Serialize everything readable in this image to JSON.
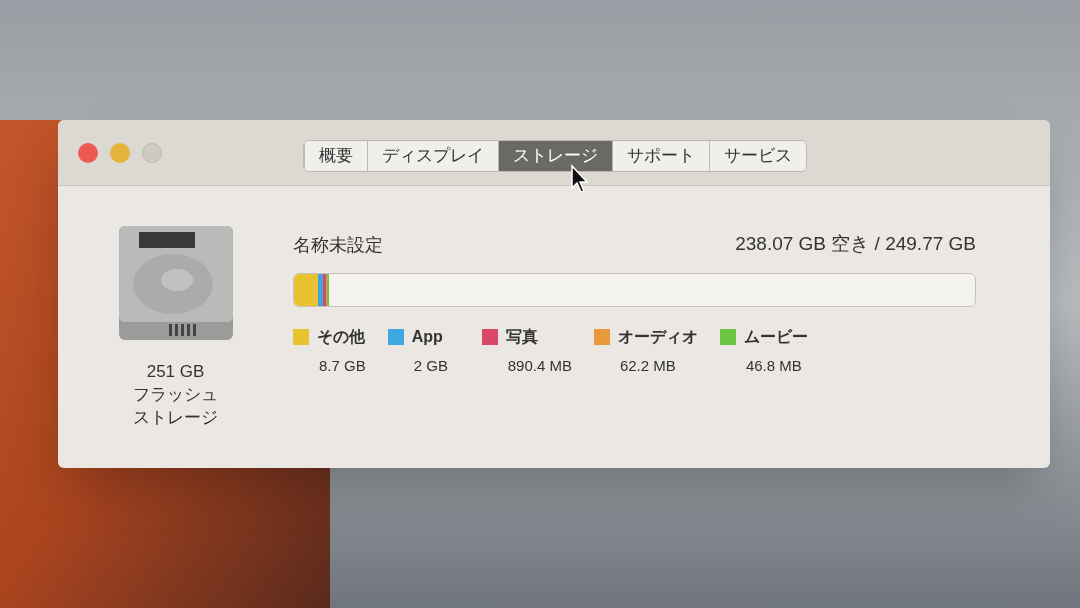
{
  "tabs": [
    {
      "label": "概要",
      "selected": false
    },
    {
      "label": "ディスプレイ",
      "selected": false
    },
    {
      "label": "ストレージ",
      "selected": true
    },
    {
      "label": "サポート",
      "selected": false
    },
    {
      "label": "サービス",
      "selected": false
    }
  ],
  "drive": {
    "capacity": "251 GB",
    "type_line_1": "フラッシュ",
    "type_line_2": "ストレージ"
  },
  "volume": {
    "name": "名称未設定",
    "summary": "238.07 GB 空き / 249.77 GB",
    "segments": [
      {
        "label": "その他",
        "size": "8.7 GB",
        "color": "#e8c230"
      },
      {
        "label": "App",
        "size": "2 GB",
        "color": "#3fa7e0"
      },
      {
        "label": "写真",
        "size": "890.4 MB",
        "color": "#d94868"
      },
      {
        "label": "オーディオ",
        "size": "62.2 MB",
        "color": "#e89a3a"
      },
      {
        "label": "ムービー",
        "size": "46.8 MB",
        "color": "#6cc644"
      }
    ]
  },
  "usage_bar": [
    {
      "level": 0.035
    },
    {
      "level": 0.008
    },
    {
      "level": 0.0036
    },
    {
      "level": 0.00025
    },
    {
      "level": 0.0002
    }
  ]
}
